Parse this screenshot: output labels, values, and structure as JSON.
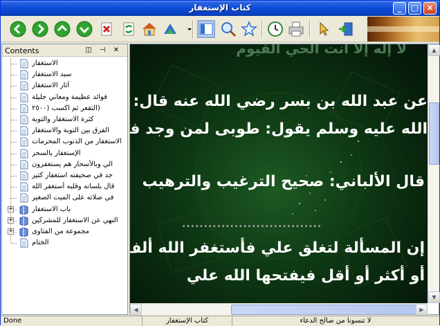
{
  "window": {
    "title": "كتاب الإستغفار"
  },
  "toolbar": {
    "buttons": [
      {
        "name": "back-icon",
        "label": "Back"
      },
      {
        "name": "forward-icon",
        "label": "Forward"
      },
      {
        "name": "up-icon",
        "label": "Previous"
      },
      {
        "name": "down-icon",
        "label": "Next"
      },
      {
        "name": "stop-icon",
        "label": "Stop"
      },
      {
        "name": "refresh-icon",
        "label": "Refresh"
      },
      {
        "name": "home-icon",
        "label": "Home"
      },
      {
        "name": "sync-icon",
        "label": "Locate"
      },
      {
        "name": "contents-icon",
        "label": "Contents"
      },
      {
        "name": "search-icon",
        "label": "Search"
      },
      {
        "name": "favorites-icon",
        "label": "Favorites"
      },
      {
        "name": "history-icon",
        "label": "History"
      },
      {
        "name": "print-icon",
        "label": "Print"
      },
      {
        "name": "cursor-icon",
        "label": "Select"
      },
      {
        "name": "exit-icon",
        "label": "Exit"
      }
    ]
  },
  "contents": {
    "title": "Contents",
    "items": [
      {
        "label": "الاستغفار",
        "type": "page"
      },
      {
        "label": "سيد الاستغفار",
        "type": "page"
      },
      {
        "label": "آثار الاستغفار",
        "type": "page"
      },
      {
        "label": "فوائد عظيمة ومعاني جليلة",
        "type": "page"
      },
      {
        "label": "(التقعر ثم اكسب (٢٥٠٠",
        "type": "page"
      },
      {
        "label": "كثرة الاستغفار والتوبة",
        "type": "page"
      },
      {
        "label": "الفرق بين التوبة والاستغفار",
        "type": "page"
      },
      {
        "label": "الاستغفار من الذنوب المحرمات",
        "type": "page"
      },
      {
        "label": "الإستغفار بالسحر",
        "type": "page"
      },
      {
        "label": "الي وبالأسحار هم يستغفرون",
        "type": "page"
      },
      {
        "label": "جد في صحيفته استغفار كثير",
        "type": "page"
      },
      {
        "label": "قال بلسانه وقلبه أستغفر الله",
        "type": "page"
      },
      {
        "label": "في صلاته على الميت الصغير",
        "type": "page"
      },
      {
        "label": "باب الاستغفار",
        "type": "book"
      },
      {
        "label": "النهي عن الاستغفار للمشركين",
        "type": "book"
      },
      {
        "label": "مجموعة من الفتاوى",
        "type": "book"
      },
      {
        "label": "الختام",
        "type": "page"
      }
    ]
  },
  "viewer": {
    "lines": [
      "لا إله إلا أنت الحي القيوم",
      "عن عبد الله بن بسر رضي الله عنه قال: سمعت",
      "الله عليه وسلم يقول: طوبى لمن وجد في صحيفته",
      "قال الألباني: صحيح الترغيب والترهيب",
      "إن المسألة لتغلق علي فأستغفر الله ألف",
      "أو أكثر أو أقل فيفتحها الله علي"
    ],
    "dots": "................................"
  },
  "status": {
    "left": "Done",
    "middle": "كتاب الإستغفار",
    "right": "لا تنسونا من صالح الدعاء"
  },
  "colors": {
    "title_bar": "#0a4ad6",
    "content_bg": "#0f3a14",
    "content_text": "#ffffff"
  }
}
